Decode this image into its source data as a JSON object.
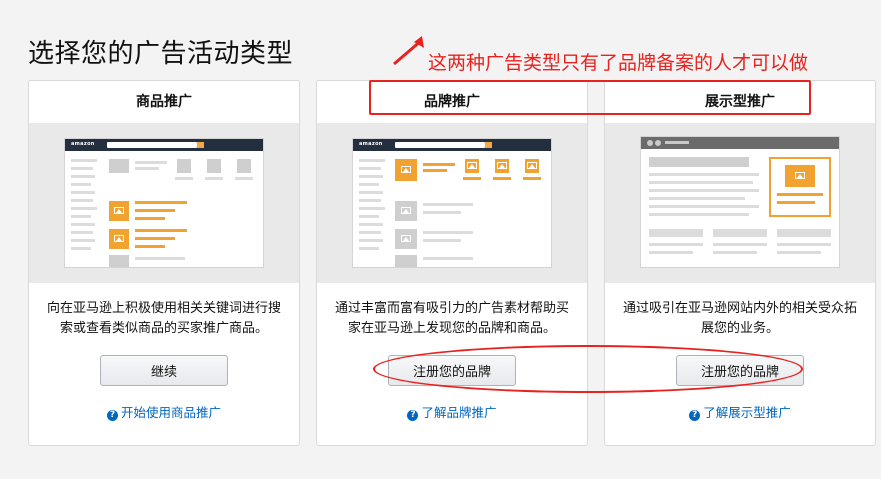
{
  "page": {
    "title": "选择您的广告活动类型"
  },
  "annotation": {
    "text": "这两种广告类型只有了品牌备案的人才可以做",
    "color": "#e8231f"
  },
  "cards": [
    {
      "title": "商品推广",
      "description": "向在亚马逊上积极使用相关关键词进行搜索或查看类似商品的买家推广商品。",
      "button": "继续",
      "help": "开始使用商品推广"
    },
    {
      "title": "品牌推广",
      "description": "通过丰富而富有吸引力的广告素材帮助买家在亚马逊上发现您的品牌和商品。",
      "button": "注册您的品牌",
      "help": "了解品牌推广"
    },
    {
      "title": "展示型推广",
      "description": "通过吸引在亚马逊网站内外的相关受众拓展您的业务。",
      "button": "注册您的品牌",
      "help": "了解展示型推广"
    }
  ],
  "mock": {
    "logo": "amazon"
  },
  "colors": {
    "accent": "#f0a331",
    "link": "#0066c0",
    "nav": "#232f3e"
  }
}
